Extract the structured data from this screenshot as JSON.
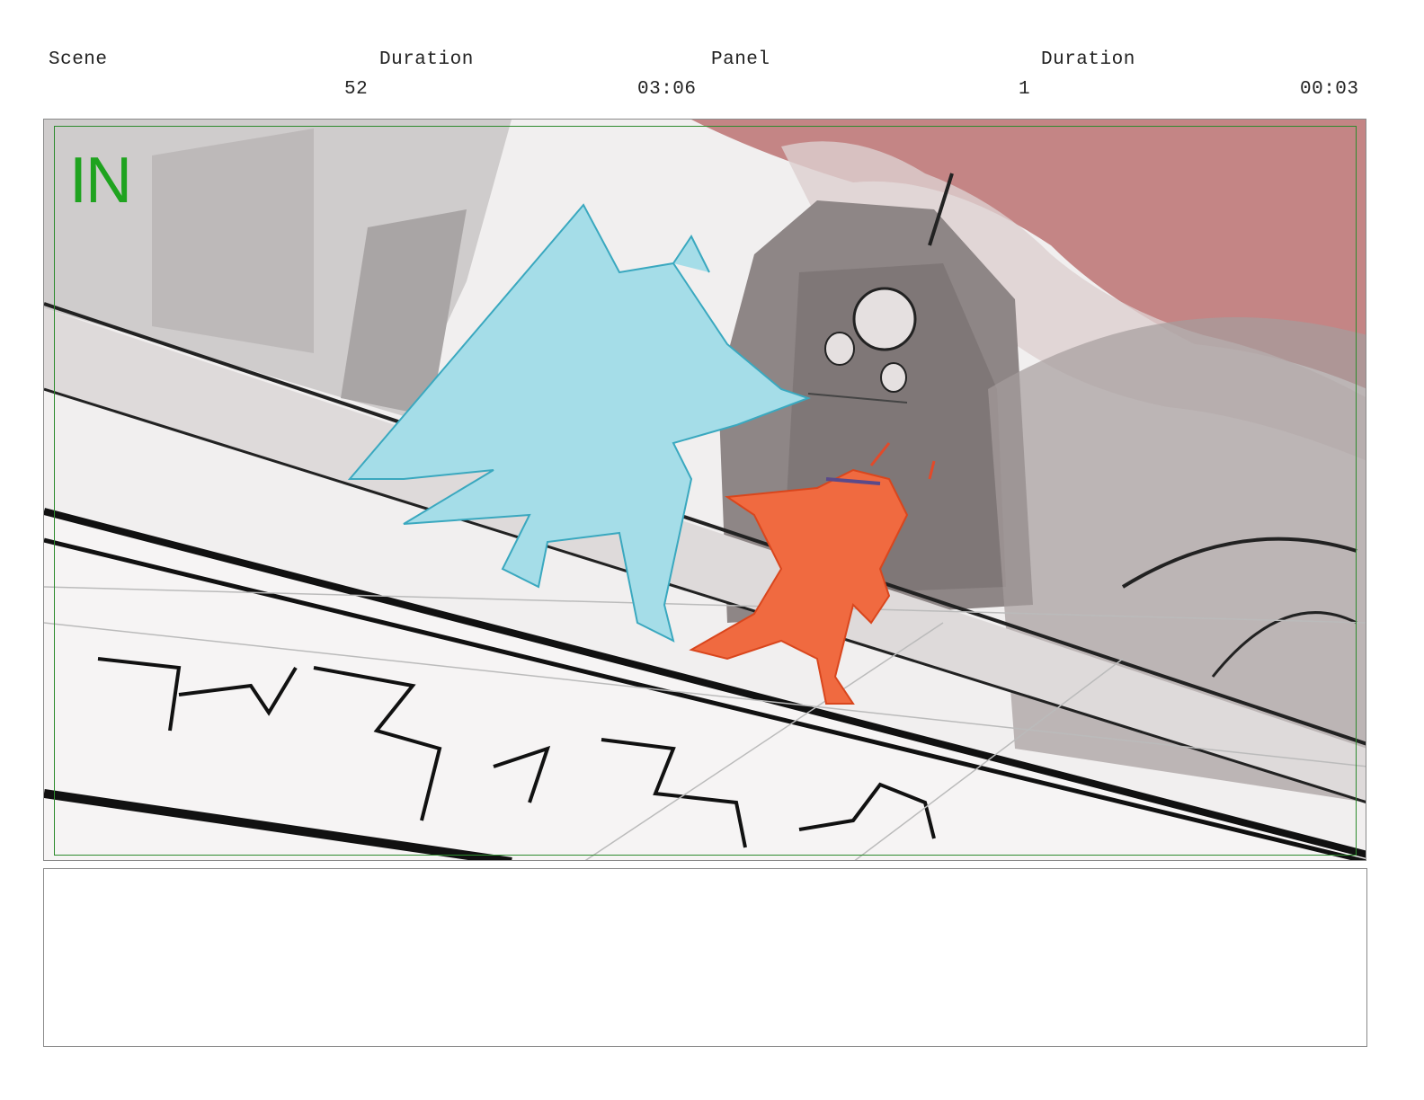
{
  "header": {
    "scene_label": "Scene",
    "scene_duration_label": "Duration",
    "panel_label": "Panel",
    "panel_duration_label": "Duration",
    "scene_number": "52",
    "scene_duration": "03:06",
    "panel_number": "1",
    "panel_duration": "00:03"
  },
  "panel_image": {
    "mark_text": "IN",
    "colors": {
      "sky": "#c48585",
      "cathedral": "#8e8686",
      "hero_blue": "#a5dde8",
      "devil_red": "#f06a40",
      "frame": "#2e8b2e"
    }
  },
  "notes": {
    "text": ""
  }
}
